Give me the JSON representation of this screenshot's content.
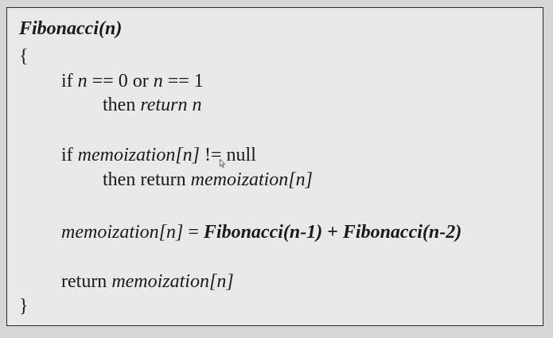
{
  "code": {
    "signature": "Fibonacci(n)",
    "open_brace": "{",
    "line_if1": {
      "kw_if": "if ",
      "var_n1": "n",
      "cond_mid": " == 0 or  ",
      "var_n2": "n",
      "cond_end": " == 1"
    },
    "line_then1": {
      "kw_then": "then ",
      "ret": "return n"
    },
    "line_if2": {
      "kw_if": "if ",
      "memo": "memoization[n]",
      "cond_end": " != null"
    },
    "line_then2": {
      "kw": "then return ",
      "memo": "memoization[n]"
    },
    "line_assign": {
      "memo": "memoization[n]",
      "eq": " = ",
      "fib1": "Fibonacci(n-1)",
      "plus": " + ",
      "fib2": "Fibonacci(n-2)"
    },
    "line_return": {
      "kw": "return ",
      "memo": "memoization[n]"
    },
    "close_brace": "}"
  },
  "colors": {
    "background": "#d7d7d7",
    "panel": "#e9e9e9",
    "border": "#2b2b2b",
    "text": "#1a1a1a"
  },
  "icons": [
    "mouse-cursor-icon"
  ]
}
